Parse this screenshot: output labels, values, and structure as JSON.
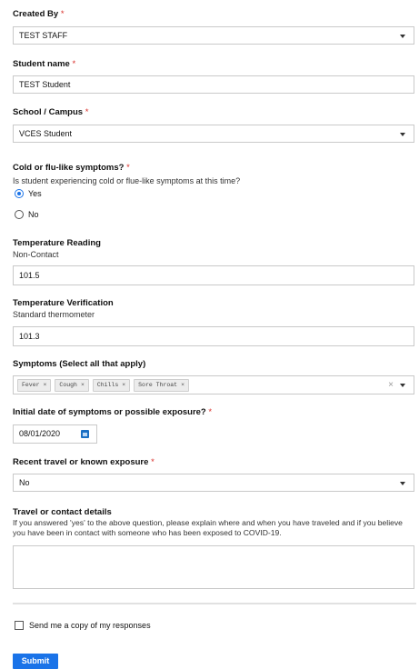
{
  "form": {
    "created_by": {
      "label": "Created By",
      "required_mark": "*",
      "value": "TEST STAFF"
    },
    "student_name": {
      "label": "Student name",
      "required_mark": "*",
      "value": "TEST Student"
    },
    "school_campus": {
      "label": "School / Campus",
      "required_mark": "*",
      "value": "VCES Student"
    },
    "cold_flu": {
      "label": "Cold or flu-like symptoms?",
      "required_mark": "*",
      "description": "Is student experiencing cold or flue-like symptoms at this time?",
      "options": [
        {
          "label": "Yes",
          "selected": true
        },
        {
          "label": "No",
          "selected": false
        }
      ]
    },
    "temperature_reading": {
      "label": "Temperature Reading",
      "description": "Non-Contact",
      "value": "101.5"
    },
    "temperature_verification": {
      "label": "Temperature Verification",
      "description": "Standard thermometer",
      "value": "101.3"
    },
    "symptoms": {
      "label": "Symptoms (Select all that apply)",
      "chips": [
        "Fever",
        "Cough",
        "Chills",
        "Sore Throat"
      ],
      "chip_remove": "×",
      "clear": "×"
    },
    "initial_date": {
      "label": "Initial date of symptoms or possible exposure?",
      "required_mark": "*",
      "value": "08/01/2020",
      "icon": "calendar-icon"
    },
    "recent_travel": {
      "label": "Recent travel or known exposure",
      "required_mark": "*",
      "value": "No"
    },
    "travel_details": {
      "label": "Travel or contact details",
      "description": "If you answered 'yes' to the above question, please explain where and when you have traveled and if you believe you have been in contact with someone who has been exposed to COVID-19.",
      "value": ""
    },
    "send_copy": {
      "label": "Send me a copy of my responses",
      "checked": false
    },
    "submit_label": "Submit"
  },
  "colors": {
    "accent": "#1a73e8",
    "required": "#d9302b",
    "border": "#c9c9c9"
  }
}
